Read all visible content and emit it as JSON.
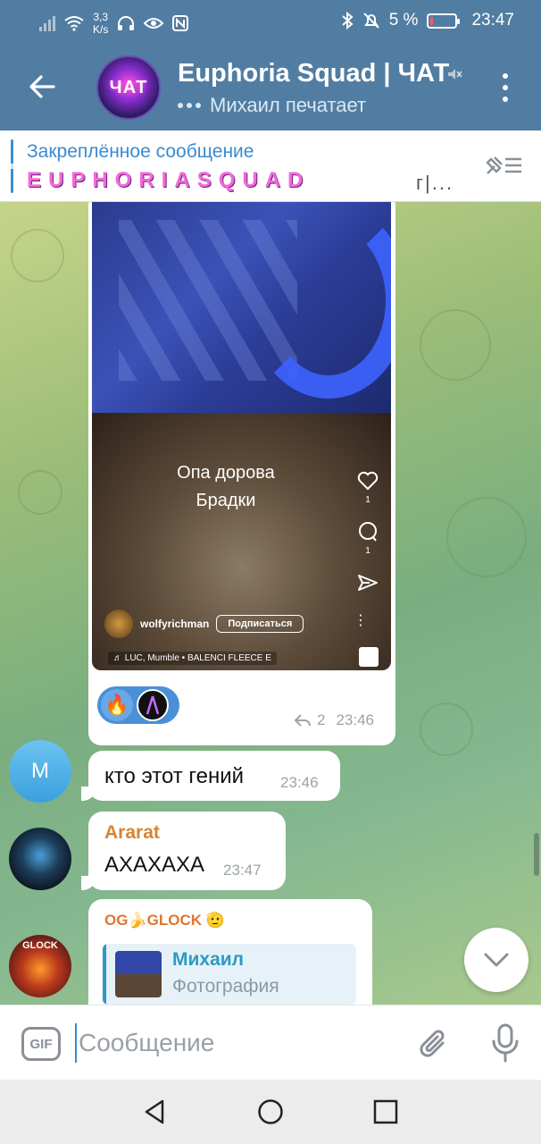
{
  "status_bar": {
    "net_speed_value": "3,3",
    "net_speed_unit": "K/s",
    "battery_percent": "5 %",
    "time": "23:47"
  },
  "header": {
    "title": "Euphoria Squad | ЧАТ",
    "subtitle": "Михаил печатает",
    "avatar_text": "ЧАТ"
  },
  "pinned": {
    "title": "Закреплённое сообщение",
    "text": "EUPHORIASQUAD",
    "tail": "г|..."
  },
  "media_message": {
    "caption_line1": "Опа дорова",
    "caption_line2": "Брадки",
    "likes": "1",
    "comments": "1",
    "author": "wolfyrichman",
    "subscribe": "Подписаться",
    "music": "♬ LUC, Mumble • BALENCI FLEECE E",
    "reaction_fire": "🔥",
    "replies": "2",
    "time": "23:46"
  },
  "messages": [
    {
      "avatar_letter": "M",
      "text": "кто этот гений",
      "time": "23:46"
    },
    {
      "sender": "Ararat",
      "text": "АХАХАХА",
      "time": "23:47"
    },
    {
      "sender": "OG🍌GLOCK 🫡",
      "reply_name": "Михаил",
      "reply_text": "Фотография",
      "avatar_text": "GLOCK"
    }
  ],
  "input": {
    "gif_label": "GIF",
    "placeholder": "Сообщение"
  },
  "colors": {
    "header_bg": "#517da2",
    "accent": "#3a8ad0",
    "sender_ararat": "#d7852f",
    "sender_glock": "#e0752e"
  }
}
